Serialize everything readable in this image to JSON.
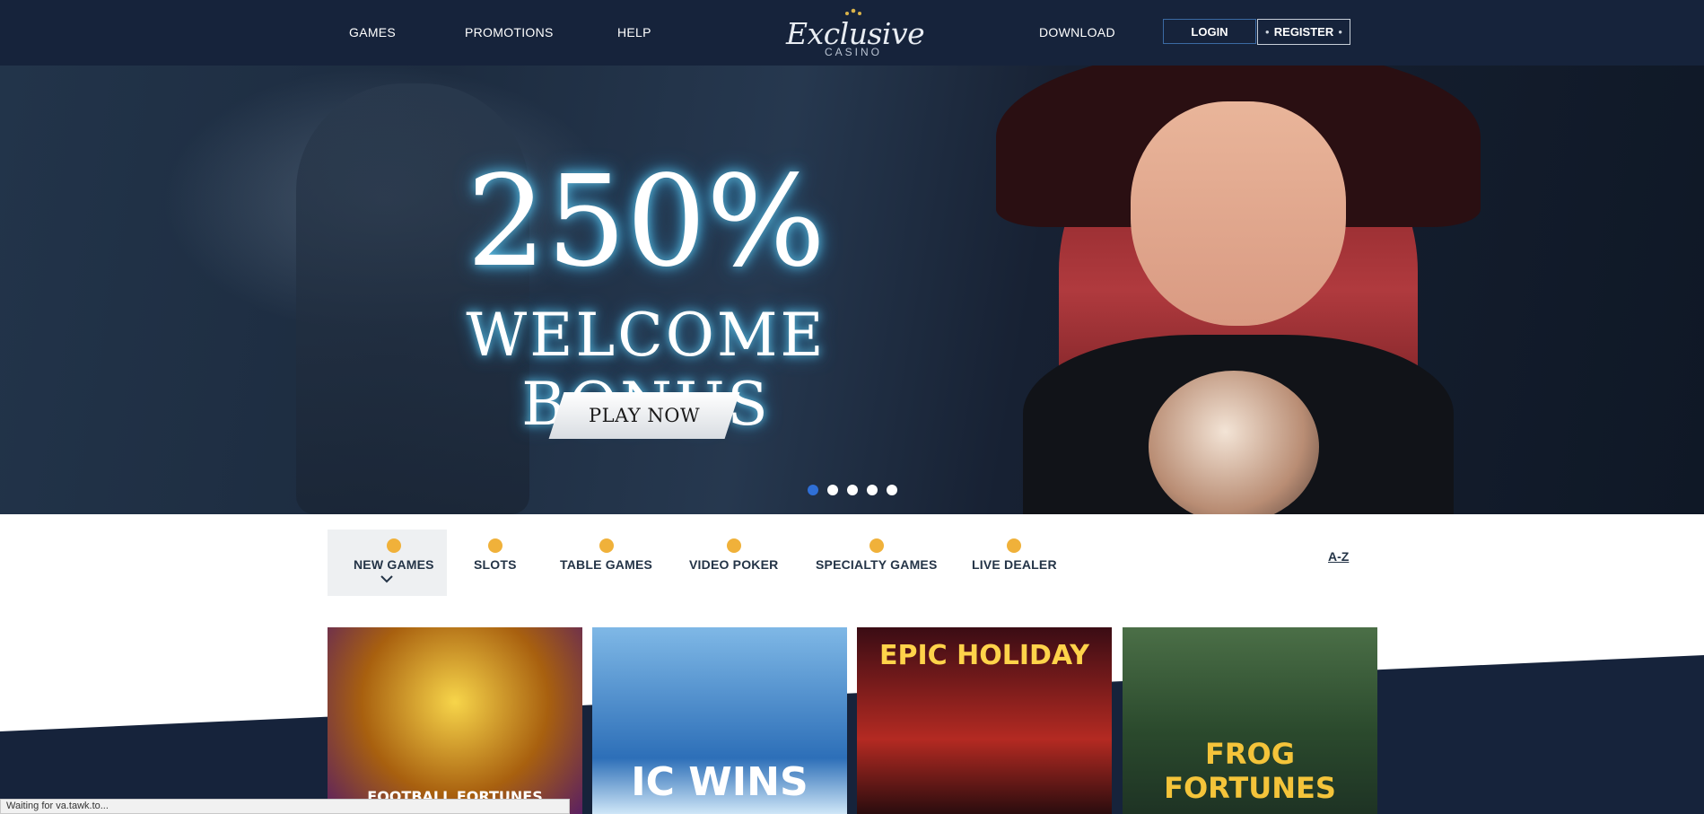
{
  "header": {
    "nav": [
      {
        "label": "GAMES"
      },
      {
        "label": "PROMOTIONS"
      },
      {
        "label": "HELP"
      },
      {
        "label": "DOWNLOAD"
      }
    ],
    "logo_script": "Exclusive",
    "logo_sub": "CASINO",
    "login_label": "LOGIN",
    "register_label": "REGISTER"
  },
  "hero": {
    "title": "250%",
    "subtitle": "WELCOME BONUS",
    "cta": "PLAY NOW",
    "slides_total": 5,
    "active_slide": 1
  },
  "categories": [
    {
      "label": "NEW GAMES",
      "icon": "new-games-icon",
      "active": true
    },
    {
      "label": "SLOTS",
      "icon": "slots-icon"
    },
    {
      "label": "TABLE GAMES",
      "icon": "table-games-icon"
    },
    {
      "label": "VIDEO POKER",
      "icon": "video-poker-icon"
    },
    {
      "label": "SPECIALTY GAMES",
      "icon": "specialty-games-icon"
    },
    {
      "label": "LIVE DEALER",
      "icon": "live-dealer-icon"
    }
  ],
  "az_label": "A-Z",
  "games": [
    {
      "name": "FOOTBALL FORTUNES"
    },
    {
      "name": "IC WINS"
    },
    {
      "name": "EPIC HOLIDAY"
    },
    {
      "name": "FROG FORTUNES"
    }
  ],
  "status_bar": "Waiting for va.tawk.to...",
  "colors": {
    "header_bg": "#16233b",
    "accent_blue": "#2f6fd6",
    "category_text": "#243447",
    "icon_gold": "#f0b13a"
  }
}
